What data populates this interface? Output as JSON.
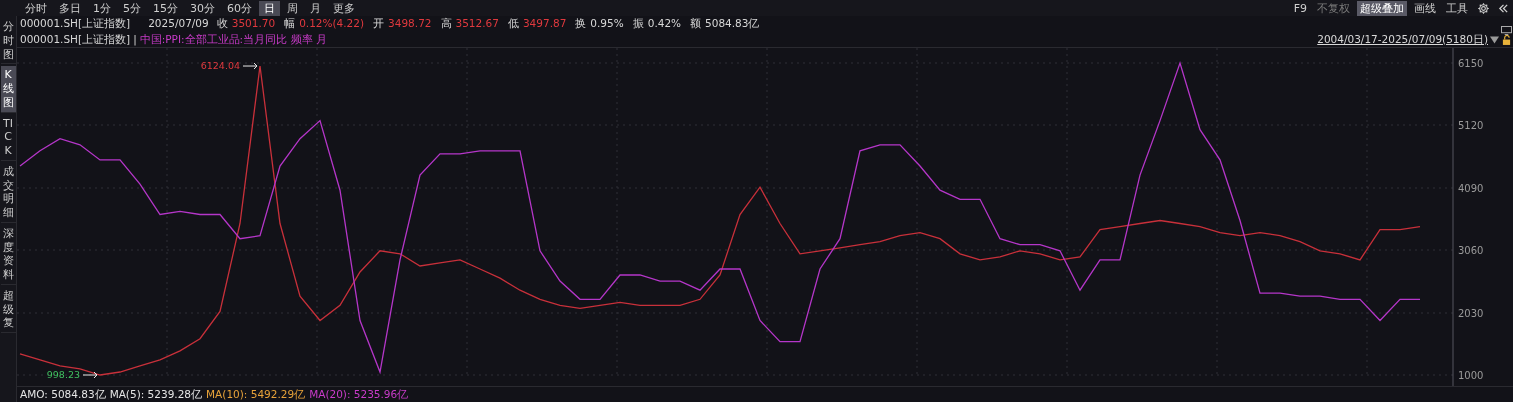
{
  "periods": [
    {
      "label": "分时",
      "selected": false
    },
    {
      "label": "多日",
      "selected": false
    },
    {
      "label": "1分",
      "selected": false
    },
    {
      "label": "5分",
      "selected": false
    },
    {
      "label": "15分",
      "selected": false
    },
    {
      "label": "30分",
      "selected": false
    },
    {
      "label": "60分",
      "selected": false
    },
    {
      "label": "日",
      "selected": true
    },
    {
      "label": "周",
      "selected": false
    },
    {
      "label": "月",
      "selected": false
    },
    {
      "label": "更多",
      "selected": false
    }
  ],
  "tools": [
    {
      "label": "F9",
      "selected": false,
      "disabled": false
    },
    {
      "label": "不复权",
      "selected": false,
      "disabled": true
    },
    {
      "label": "超级叠加",
      "selected": true,
      "disabled": false
    },
    {
      "label": "画线",
      "selected": false,
      "disabled": false
    },
    {
      "label": "工具",
      "selected": false,
      "disabled": false
    }
  ],
  "side_tabs": [
    {
      "label": "分时图",
      "selected": false
    },
    {
      "label": "K线图",
      "selected": true
    },
    {
      "label": "TICK",
      "selected": false
    },
    {
      "label": "成交明细",
      "selected": false
    },
    {
      "label": "深度资料",
      "selected": false
    },
    {
      "label": "超级复",
      "selected": false
    }
  ],
  "quote": {
    "symbol": "000001.SH[上证指数]",
    "date": "2025/07/09",
    "fields": [
      {
        "label": "收",
        "value": "3501.70",
        "kind": "up"
      },
      {
        "label": "幅",
        "value": "0.12%(4.22)",
        "kind": "up"
      },
      {
        "label": "开",
        "value": "3498.72",
        "kind": "up"
      },
      {
        "label": "高",
        "value": "3512.67",
        "kind": "up"
      },
      {
        "label": "低",
        "value": "3497.87",
        "kind": "up"
      },
      {
        "label": "换",
        "value": "0.95%",
        "kind": "plain"
      },
      {
        "label": "振",
        "value": "0.42%",
        "kind": "plain"
      },
      {
        "label": "额",
        "value": "5084.83亿",
        "kind": "plain"
      }
    ]
  },
  "legend": {
    "separator": "|",
    "frequency": "频率 月",
    "date_range": "2004/03/17-2025/07/09(5180日)"
  },
  "chart": {
    "chart_data": {
      "type": "line",
      "grid": true,
      "ylim": [
        1000,
        6150
      ],
      "yticks": [
        6150,
        5120,
        4090,
        3060,
        2030,
        1000
      ],
      "annotations": [
        "6124.04",
        "998.23"
      ],
      "series": [
        {
          "name": "000001.SH[上证指数]",
          "color": "#c8303a",
          "values": [
            1350,
            1250,
            1150,
            1100,
            1000,
            1050,
            1150,
            1250,
            1400,
            1600,
            2050,
            3500,
            6100,
            3500,
            2300,
            1900,
            2150,
            2700,
            3050,
            3000,
            2800,
            2850,
            2900,
            2750,
            2600,
            2400,
            2250,
            2150,
            2100,
            2150,
            2200,
            2150,
            2150,
            2150,
            2250,
            2650,
            3650,
            4100,
            3500,
            3000,
            3050,
            3100,
            3150,
            3200,
            3300,
            3350,
            3250,
            3000,
            2900,
            2950,
            3050,
            3000,
            2900,
            2950,
            3400,
            3450,
            3500,
            3550,
            3500,
            3450,
            3350,
            3300,
            3350,
            3300,
            3200,
            3050,
            3000,
            2900,
            3400,
            3400,
            3450
          ]
        },
        {
          "name": "中国:PPI:全部工业品:当月同比",
          "color": "#b536c9",
          "values": [
            4450,
            4700,
            4900,
            4800,
            4550,
            4550,
            4150,
            3650,
            3700,
            3650,
            3650,
            3250,
            3300,
            4450,
            4900,
            5200,
            4050,
            1900,
            1050,
            2900,
            4300,
            4650,
            4650,
            4700,
            4700,
            4700,
            3050,
            2550,
            2250,
            2250,
            2650,
            2650,
            2550,
            2550,
            2400,
            2750,
            2750,
            1900,
            1550,
            1550,
            2750,
            3250,
            4700,
            4800,
            4800,
            4450,
            4050,
            3900,
            3900,
            3250,
            3150,
            3150,
            3050,
            2400,
            2900,
            2900,
            4300,
            5200,
            6150,
            5050,
            4550,
            3550,
            2350,
            2350,
            2300,
            2300,
            2250,
            2250,
            1900,
            2250,
            2250
          ]
        }
      ]
    }
  },
  "stats": [
    {
      "text": "AMO: 5084.83亿",
      "color": "#e6e6e6"
    },
    {
      "text": "MA(5): 5239.28亿",
      "color": "#e6e6e6"
    },
    {
      "text": "MA(10): 5492.29亿",
      "color": "#e8a33a"
    },
    {
      "text": "MA(20): 5235.96亿",
      "color": "#c93bc9"
    }
  ]
}
